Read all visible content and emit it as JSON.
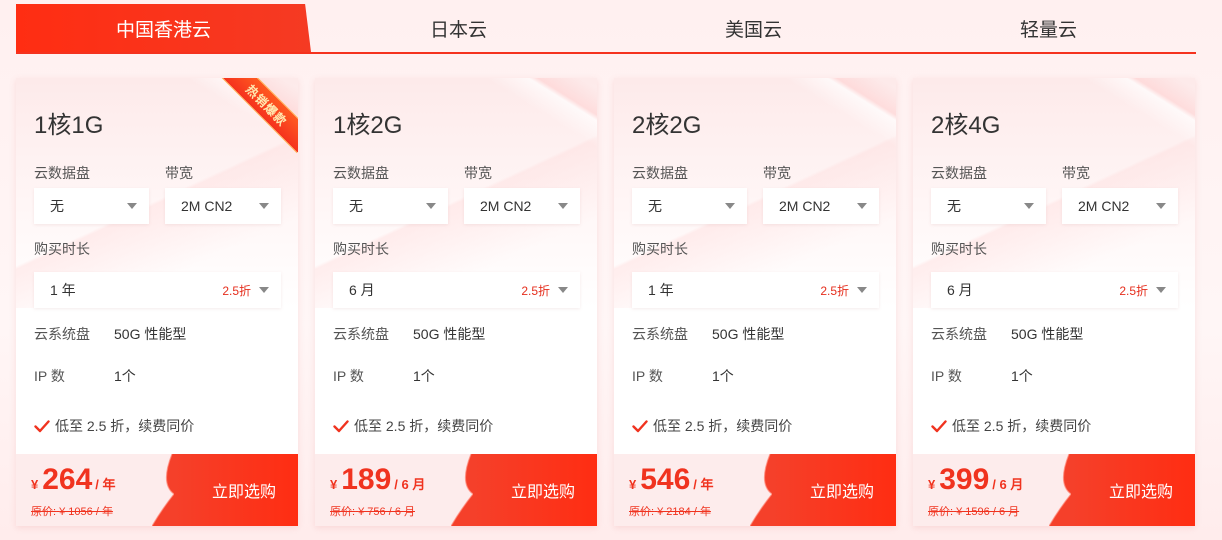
{
  "tabs": [
    {
      "label": "中国香港云",
      "active": true
    },
    {
      "label": "日本云",
      "active": false
    },
    {
      "label": "美国云",
      "active": false
    },
    {
      "label": "轻量云",
      "active": false
    }
  ],
  "common": {
    "disk_label": "云数据盘",
    "bandwidth_label": "带宽",
    "duration_label": "购买时长",
    "system_disk_label": "云系统盘",
    "system_disk_value": "50G 性能型",
    "ip_label": "IP 数",
    "ip_value": "1个",
    "feature": "低至 2.5 折，续费同价",
    "buy_label": "立即选购",
    "orig_prefix": "原价:",
    "currency": "¥"
  },
  "cards": [
    {
      "name": "1核1G",
      "hot_badge": "热销爆款",
      "disk": "无",
      "bandwidth": "2M CN2",
      "duration": "1 年",
      "discount": "2.5折",
      "price": "264",
      "unit": "/ 年",
      "orig_price": "¥ 1056 / 年"
    },
    {
      "name": "1核2G",
      "disk": "无",
      "bandwidth": "2M CN2",
      "duration": "6 月",
      "discount": "2.5折",
      "price": "189",
      "unit": "/ 6 月",
      "orig_price": "¥ 756 / 6 月"
    },
    {
      "name": "2核2G",
      "disk": "无",
      "bandwidth": "2M CN2",
      "duration": "1 年",
      "discount": "2.5折",
      "price": "546",
      "unit": "/ 年",
      "orig_price": "¥ 2184 / 年"
    },
    {
      "name": "2核4G",
      "disk": "无",
      "bandwidth": "2M CN2",
      "duration": "6 月",
      "discount": "2.5折",
      "price": "399",
      "unit": "/ 6 月",
      "orig_price": "¥ 1596 / 6 月"
    }
  ],
  "colors": {
    "accent": "#f5321e",
    "price": "#f0331f",
    "check": "#f0331f"
  }
}
